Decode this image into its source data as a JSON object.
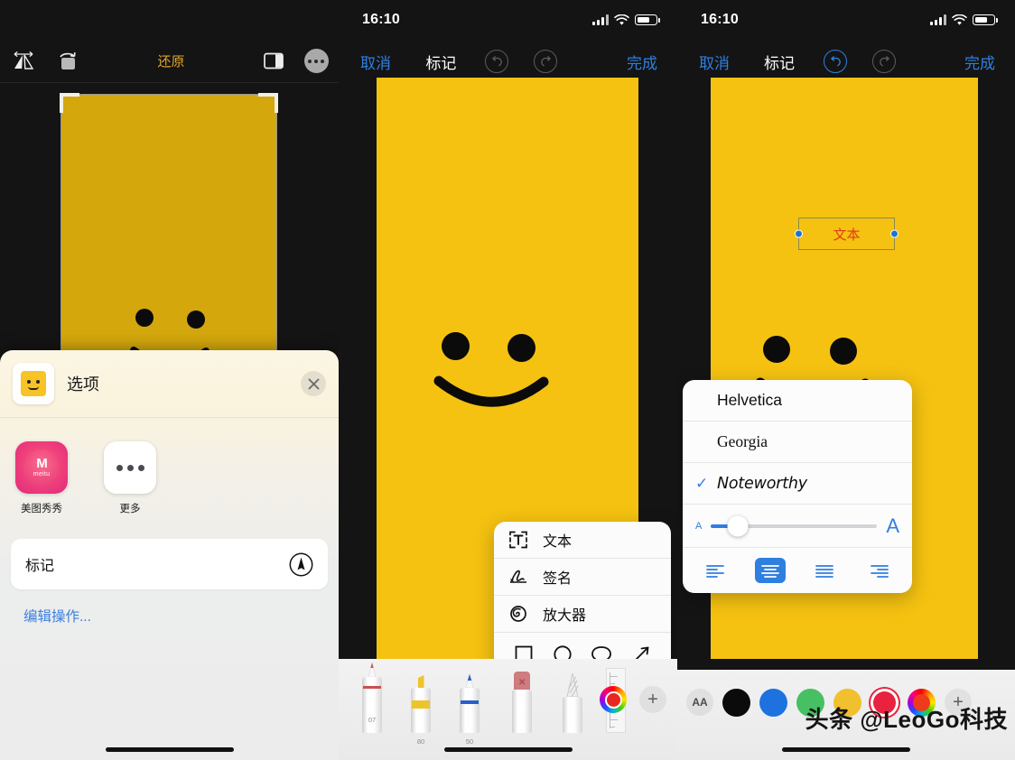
{
  "panel1": {
    "toolbar": {
      "flip_icon": "flip-horizontal-icon",
      "rotate_icon": "rotate-icon",
      "revert_label": "还原",
      "aspect_icon": "aspect-ratio-icon",
      "more_icon": "more-options-icon"
    },
    "share_sheet": {
      "title": "选项",
      "close_icon": "close-icon",
      "thumbnail_name": "photo-thumbnail",
      "apps": [
        {
          "label": "美图秀秀",
          "icon": "meitu-app-icon",
          "brand": "meitu"
        },
        {
          "label": "更多",
          "icon": "more-apps-icon"
        }
      ],
      "action_row": {
        "label": "标记",
        "icon": "markup-pen-icon"
      },
      "edit_actions_label": "编辑操作..."
    }
  },
  "panel2": {
    "status": {
      "time": "16:10",
      "signal_icon": "cellular-signal-icon",
      "wifi_icon": "wifi-icon",
      "battery_icon": "battery-icon"
    },
    "nav": {
      "cancel_label": "取消",
      "title": "标记",
      "undo_icon": "undo-icon",
      "redo_icon": "redo-icon",
      "done_label": "完成",
      "undo_enabled": "false",
      "redo_enabled": "false"
    },
    "markup_menu": {
      "items": [
        {
          "label": "文本",
          "icon": "text-box-icon"
        },
        {
          "label": "签名",
          "icon": "signature-icon"
        },
        {
          "label": "放大器",
          "icon": "magnifier-icon"
        }
      ],
      "shapes": [
        {
          "icon": "square-shape-icon"
        },
        {
          "icon": "circle-shape-icon"
        },
        {
          "icon": "speech-bubble-shape-icon"
        },
        {
          "icon": "arrow-shape-icon"
        }
      ]
    },
    "tool_bar": {
      "pens": [
        {
          "name": "pen-tool",
          "value": "07",
          "color": "#c8504f"
        },
        {
          "name": "highlighter-tool",
          "value": "80",
          "color": "#eec42b"
        },
        {
          "name": "marker-tool",
          "value": "50",
          "color": "#2a5fc9"
        },
        {
          "name": "eraser-tool",
          "value": "",
          "color": "#cd7c7f"
        },
        {
          "name": "lasso-tool",
          "value": "",
          "color": "#b9b9b9"
        },
        {
          "name": "ruler-tool",
          "value": "",
          "color": "#d9d9d9"
        }
      ],
      "color_wheel_icon": "color-wheel-icon",
      "selected_color": "#e8271f",
      "add_icon": "add-icon"
    }
  },
  "panel3": {
    "status": {
      "time": "16:10",
      "signal_icon": "cellular-signal-icon",
      "wifi_icon": "wifi-icon",
      "battery_icon": "battery-icon"
    },
    "nav": {
      "cancel_label": "取消",
      "title": "标记",
      "undo_icon": "undo-icon",
      "redo_icon": "redo-icon",
      "done_label": "完成",
      "undo_enabled": "true",
      "redo_enabled": "false"
    },
    "text_object": {
      "value": "文本",
      "color": "#e03b18"
    },
    "font_popover": {
      "fonts": [
        {
          "name": "Helvetica",
          "selected": false
        },
        {
          "name": "Georgia",
          "selected": false
        },
        {
          "name": "Noteworthy",
          "selected": true
        }
      ],
      "check_icon": "checkmark-icon",
      "size_slider": {
        "small_label": "A",
        "large_label": "A",
        "value_percent": 16
      },
      "alignments": [
        {
          "icon": "align-left-icon",
          "selected": false
        },
        {
          "icon": "align-center-icon",
          "selected": true
        },
        {
          "icon": "align-justify-icon",
          "selected": false
        },
        {
          "icon": "align-right-icon",
          "selected": false
        }
      ]
    },
    "color_bar": {
      "aa_label": "AA",
      "aa_icon": "text-style-icon",
      "colors": [
        {
          "name": "black",
          "hex": "#0b0b0b",
          "selected": false
        },
        {
          "name": "blue",
          "hex": "#1d72e0",
          "selected": false
        },
        {
          "name": "green",
          "hex": "#46c062",
          "selected": false
        },
        {
          "name": "yellow",
          "hex": "#f0c02e",
          "selected": false
        },
        {
          "name": "red",
          "hex": "#e8223f",
          "selected": true
        },
        {
          "name": "color-wheel",
          "hex": "#ef3b1b",
          "selected": false
        }
      ],
      "add_icon": "add-icon"
    }
  },
  "watermark": {
    "text": "头条 @LeoGo科技"
  },
  "colors": {
    "photo_yellow": "#f5c211",
    "photo_yellow_dim": "#d4a80d",
    "accent_blue": "#2f7fe0",
    "nav_title_yellow": "#e0a62a"
  }
}
